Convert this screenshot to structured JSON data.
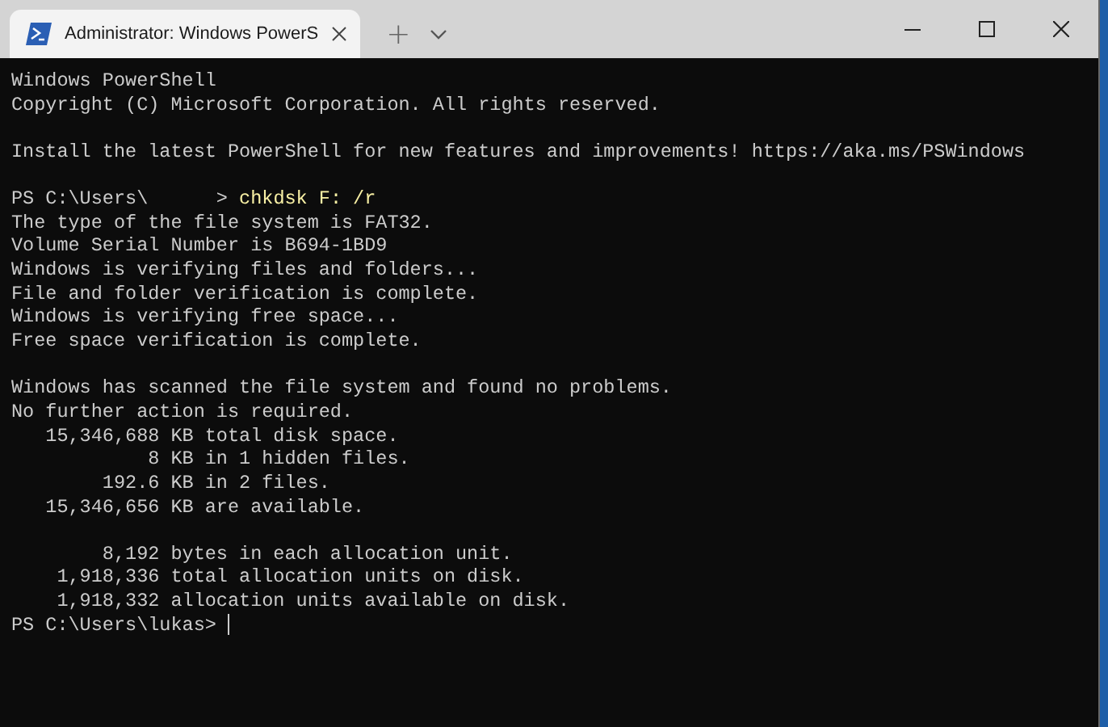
{
  "window": {
    "tab_title": "Administrator: Windows PowerS",
    "new_tab": "+"
  },
  "terminal": {
    "lines": [
      {
        "kind": "text",
        "text": "Windows PowerShell"
      },
      {
        "kind": "text",
        "text": "Copyright (C) Microsoft Corporation. All rights reserved."
      },
      {
        "kind": "blank"
      },
      {
        "kind": "text",
        "text": "Install the latest PowerShell for new features and improvements! https://aka.ms/PSWindows"
      },
      {
        "kind": "blank"
      },
      {
        "kind": "prompt",
        "prompt": "PS C:\\Users\\      >",
        "command": "chkdsk F: /r"
      },
      {
        "kind": "text",
        "text": "The type of the file system is FAT32."
      },
      {
        "kind": "text",
        "text": "Volume Serial Number is B694-1BD9"
      },
      {
        "kind": "text",
        "text": "Windows is verifying files and folders..."
      },
      {
        "kind": "text",
        "text": "File and folder verification is complete."
      },
      {
        "kind": "text",
        "text": "Windows is verifying free space..."
      },
      {
        "kind": "text",
        "text": "Free space verification is complete."
      },
      {
        "kind": "blank"
      },
      {
        "kind": "text",
        "text": "Windows has scanned the file system and found no problems."
      },
      {
        "kind": "text",
        "text": "No further action is required."
      },
      {
        "kind": "text",
        "text": "   15,346,688 KB total disk space."
      },
      {
        "kind": "text",
        "text": "            8 KB in 1 hidden files."
      },
      {
        "kind": "text",
        "text": "        192.6 KB in 2 files."
      },
      {
        "kind": "text",
        "text": "   15,346,656 KB are available."
      },
      {
        "kind": "blank"
      },
      {
        "kind": "text",
        "text": "        8,192 bytes in each allocation unit."
      },
      {
        "kind": "text",
        "text": "    1,918,336 total allocation units on disk."
      },
      {
        "kind": "text",
        "text": "    1,918,332 allocation units available on disk."
      },
      {
        "kind": "prompt",
        "prompt": "PS C:\\Users\\lukas>",
        "cursor": true
      }
    ]
  }
}
